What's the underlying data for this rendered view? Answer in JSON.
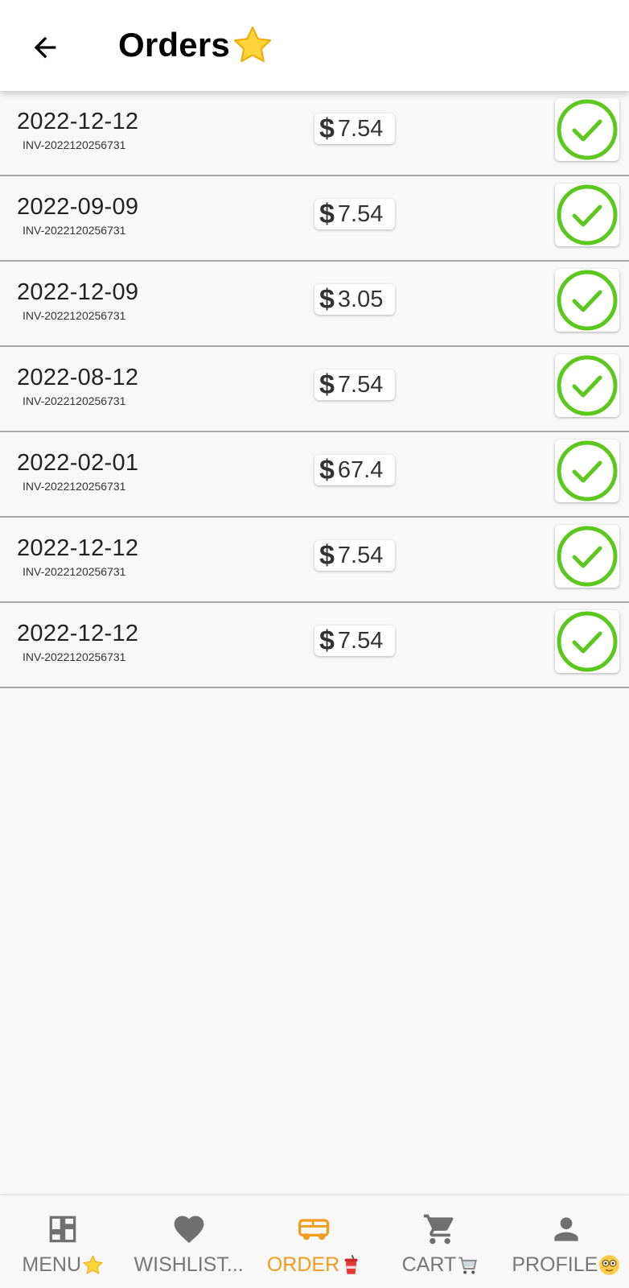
{
  "header": {
    "title": "Orders",
    "title_emoji": "star-emoji",
    "back_icon": "arrow-left-icon"
  },
  "orders": [
    {
      "date": "2022-12-12",
      "invoice": "INV-2022120256731",
      "currency": "$",
      "amount": "7.54",
      "status_icon": "check-circle-icon"
    },
    {
      "date": "2022-09-09",
      "invoice": "INV-2022120256731",
      "currency": "$",
      "amount": "7.54",
      "status_icon": "check-circle-icon"
    },
    {
      "date": "2022-12-09",
      "invoice": "INV-2022120256731",
      "currency": "$",
      "amount": "3.05",
      "status_icon": "check-circle-icon"
    },
    {
      "date": "2022-08-12",
      "invoice": "INV-2022120256731",
      "currency": "$",
      "amount": "7.54",
      "status_icon": "check-circle-icon"
    },
    {
      "date": "2022-02-01",
      "invoice": "INV-2022120256731",
      "currency": "$",
      "amount": "67.4",
      "status_icon": "check-circle-icon"
    },
    {
      "date": "2022-12-12",
      "invoice": "INV-2022120256731",
      "currency": "$",
      "amount": "7.54",
      "status_icon": "check-circle-icon"
    },
    {
      "date": "2022-12-12",
      "invoice": "INV-2022120256731",
      "currency": "$",
      "amount": "7.54",
      "status_icon": "check-circle-icon"
    }
  ],
  "bottom_nav": {
    "items": [
      {
        "label": "MENU",
        "icon": "dashboard-icon",
        "emoji": "star-emoji",
        "active": false
      },
      {
        "label": "WISHLIST...",
        "icon": "heart-icon",
        "emoji": "",
        "active": false
      },
      {
        "label": "ORDER",
        "icon": "delivery-van-icon",
        "emoji": "drink-cup-emoji",
        "active": true
      },
      {
        "label": "CART",
        "icon": "cart-icon",
        "emoji": "cart-emoji",
        "active": false
      },
      {
        "label": "PROFILE",
        "icon": "person-icon",
        "emoji": "face-glasses-emoji",
        "active": false
      }
    ]
  },
  "colors": {
    "accent": "#f29b1c",
    "check_green": "#5cc81e",
    "nav_inactive": "#777777",
    "divider": "#a8a8a8"
  }
}
